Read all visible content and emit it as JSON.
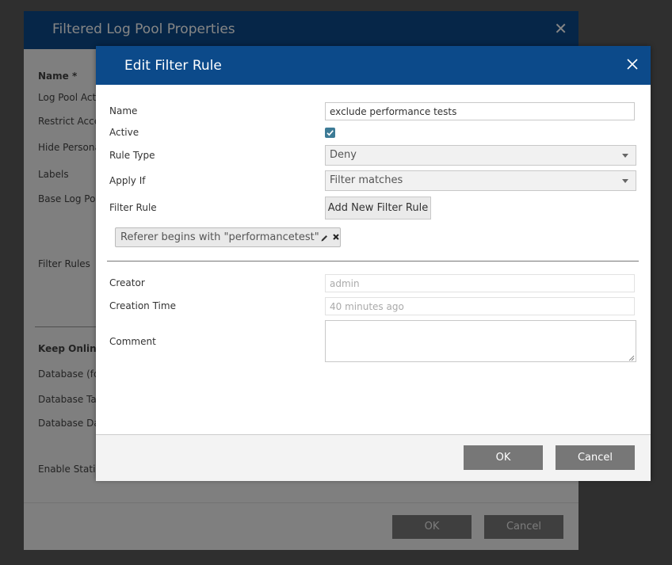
{
  "background_dialog": {
    "title": "Filtered Log Pool Properties",
    "labels": {
      "name": "Name *",
      "log_pool_active": "Log Pool Activ",
      "restrict_access": "Restrict Acces",
      "hide_personal": "Hide Persona",
      "labels": "Labels",
      "base_log_pool": "Base Log Poo",
      "filter_rules": "Filter Rules",
      "keep_online": "Keep Online L",
      "database_for": "Database (for",
      "database_table": "Database Tab",
      "database_data": "Database Dat",
      "enable_statistics": "Enable Statist"
    },
    "ok_label": "OK",
    "cancel_label": "Cancel"
  },
  "dialog": {
    "title": "Edit Filter Rule",
    "close_icon": "close-icon",
    "name": {
      "label": "Name",
      "value": "exclude performance tests"
    },
    "active": {
      "label": "Active",
      "checked": true
    },
    "rule_type": {
      "label": "Rule Type",
      "value": "Deny"
    },
    "apply_if": {
      "label": "Apply If",
      "value": "Filter matches"
    },
    "filter_rule": {
      "label": "Filter Rule",
      "add_label": "Add New Filter Rule",
      "chips": [
        {
          "text": "Referer begins with \"performancetest\""
        }
      ]
    },
    "creator": {
      "label": "Creator",
      "value": "admin"
    },
    "creation_time": {
      "label": "Creation Time",
      "value": "40 minutes ago"
    },
    "comment": {
      "label": "Comment",
      "value": ""
    },
    "ok_label": "OK",
    "cancel_label": "Cancel"
  },
  "colors": {
    "header": "#0c4a8a",
    "checkbox": "#3d7b96",
    "button": "#777777"
  }
}
